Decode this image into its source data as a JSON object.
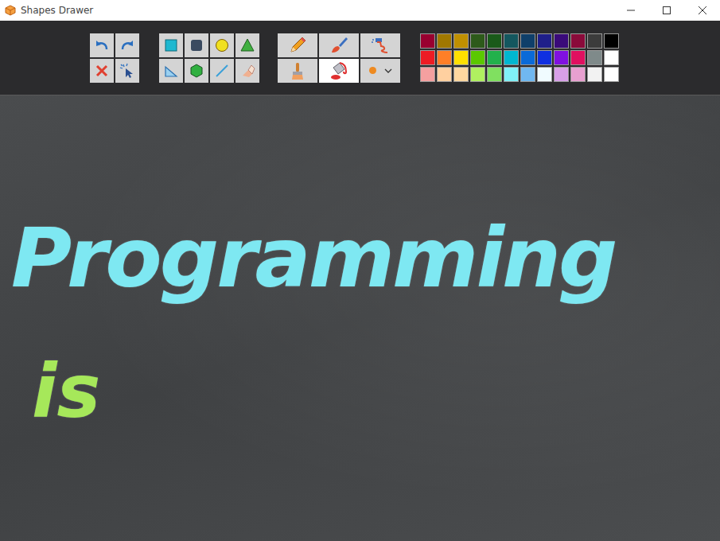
{
  "window": {
    "title": "Shapes Drawer"
  },
  "brush_tools": [
    {
      "selected": false
    },
    {
      "selected": false
    },
    {
      "selected": false
    },
    {
      "selected": false
    },
    {
      "selected": true
    },
    {
      "selected": false
    }
  ],
  "palette": [
    {
      "color": "#990030"
    },
    {
      "color": "#a07800"
    },
    {
      "color": "#c09000"
    },
    {
      "color": "#2d5a1a"
    },
    {
      "color": "#1a5a1a"
    },
    {
      "color": "#14575f"
    },
    {
      "color": "#0f3f6a"
    },
    {
      "color": "#1f1f8a"
    },
    {
      "color": "#3a0a7a"
    },
    {
      "color": "#8a0a3a"
    },
    {
      "color": "#3c3c3c"
    },
    {
      "color": "#000000"
    },
    {
      "color": "#ed1c24"
    },
    {
      "color": "#ff7f27"
    },
    {
      "color": "#ffe000"
    },
    {
      "color": "#5bc800"
    },
    {
      "color": "#22b14c"
    },
    {
      "color": "#00b7d0"
    },
    {
      "color": "#0a6ad8"
    },
    {
      "color": "#1030e0"
    },
    {
      "color": "#8010e0"
    },
    {
      "color": "#e01060"
    },
    {
      "color": "#7f8a8a"
    },
    {
      "color": "#ffffff"
    },
    {
      "color": "#f4a0a0"
    },
    {
      "color": "#ffd0a0"
    },
    {
      "color": "#ffd8a0"
    },
    {
      "color": "#b0f060"
    },
    {
      "color": "#80e060"
    },
    {
      "color": "#80f0f8"
    },
    {
      "color": "#70b8f0"
    },
    {
      "color": "#f0fbff"
    },
    {
      "color": "#d8a0e8"
    },
    {
      "color": "#e8a0d0"
    },
    {
      "color": "#f2f2f2"
    },
    {
      "color": "#ffffff"
    }
  ],
  "canvas": {
    "texts": [
      {
        "text": "Programming",
        "color": "#7ee8f2"
      },
      {
        "text": "is",
        "color": "#a6e85a"
      }
    ]
  }
}
